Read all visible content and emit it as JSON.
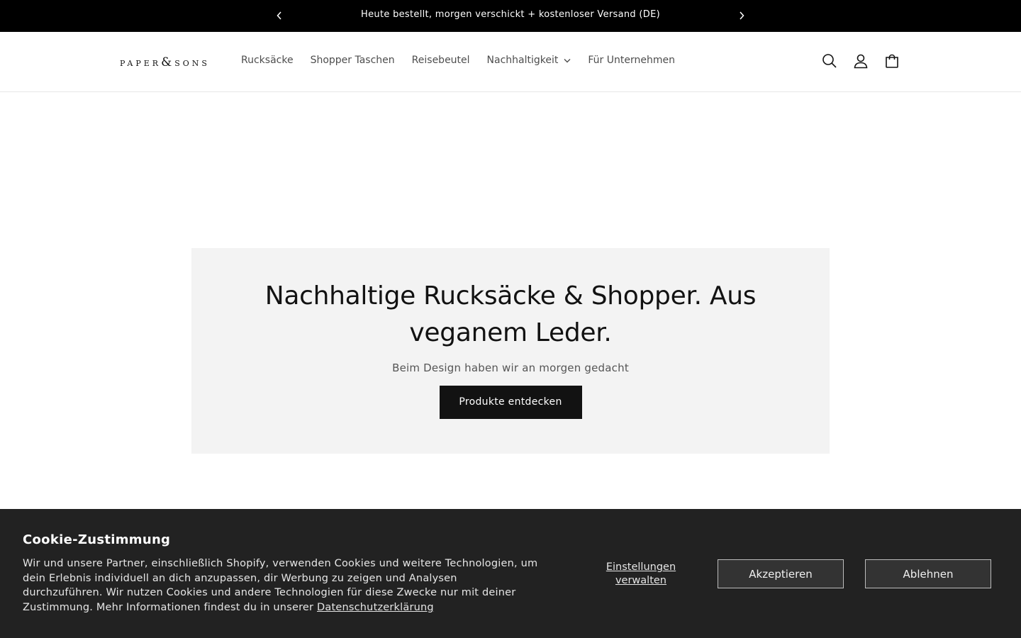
{
  "announcement": {
    "text": "Heute bestellt, morgen verschickt + kostenloser Versand (DE)"
  },
  "header": {
    "logo": {
      "word1": "PAPER",
      "ampersand": "&",
      "word2": "SONS"
    },
    "nav": [
      {
        "label": "Rucksäcke"
      },
      {
        "label": "Shopper Taschen"
      },
      {
        "label": "Reisebeutel"
      },
      {
        "label": "Nachhaltigkeit",
        "has_dropdown": true
      },
      {
        "label": "Für Unternehmen"
      }
    ],
    "icons": [
      "search-icon",
      "account-icon",
      "cart-icon"
    ]
  },
  "hero": {
    "heading": "Nachhaltige Rucksäcke & Shopper. Aus veganem Leder.",
    "subheading": "Beim Design haben wir an morgen gedacht",
    "cta_label": "Produkte entdecken"
  },
  "cookie": {
    "title": "Cookie-Zustimmung",
    "body": "Wir und unsere Partner, einschließlich Shopify, verwenden Cookies und weitere Technologien, um dein Erlebnis individuell an dich anzupassen, dir Werbung zu zeigen und Analysen durchzuführen. Wir nutzen Cookies und andere Technologien für diese Zwecke nur mit deiner Zustimmung. Mehr Informationen findest du in unserer",
    "privacy_link": "Datenschutzerklärung",
    "manage_label": "Einstellungen verwalten",
    "accept_label": "Akzeptieren",
    "decline_label": "Ablehnen"
  },
  "colors": {
    "announcement_bg": "#000000",
    "hero_bg": "#f3f3f3",
    "cta_bg": "#121212",
    "cookie_bg": "#222222"
  }
}
